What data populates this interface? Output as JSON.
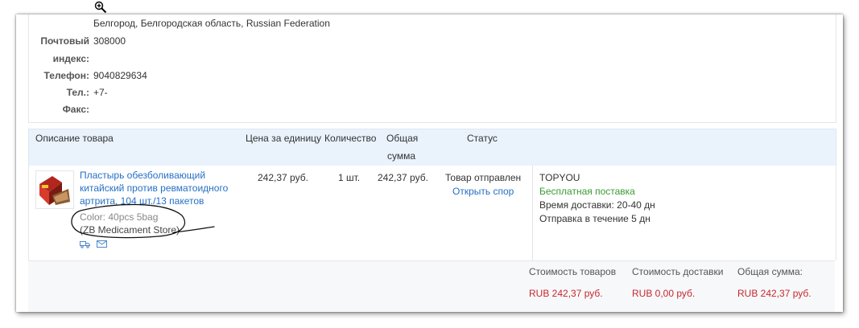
{
  "address": {
    "city_line": "Белгород, Белгородская область, Russian Federation",
    "postal_label_1": "Почтовый",
    "postal_label_2": "индекс:",
    "postal_value": "308000",
    "phone_label": "Телефон:",
    "phone_value": "9040829634",
    "tel_label": "Тел.:",
    "tel_value": "+7-",
    "fax_label": "Факс:",
    "fax_value": ""
  },
  "table": {
    "headers": {
      "description": "Описание товара",
      "unit_price": "Цена за единицу",
      "quantity": "Количество",
      "total_1": "Общая",
      "total_2": "сумма",
      "status": "Статус"
    }
  },
  "item": {
    "title": "Пластырь обезболивающий китайский против ревматоидного артрита, 104 шт./13 пакетов",
    "color": "Color: 40pcs 5bag",
    "store": "(ZB Medicament Store)",
    "unit_price": "242,37 руб.",
    "quantity": "1 шт.",
    "total": "242,37 руб.",
    "status": "Товар отправлен",
    "dispute_link": "Открыть спор",
    "seller": "TOPYOU",
    "free_shipping": "Бесплатная поставка",
    "delivery_time": "Время доставки:  20-40 дн",
    "dispatch_time": "Отправка в течение  5 дн"
  },
  "totals": {
    "goods_label": "Стоимость товаров",
    "goods_value": "RUB 242,37 руб.",
    "shipping_label": "Стоимость доставки",
    "shipping_value": "RUB 0,00 руб.",
    "total_label": "Общая сумма:",
    "total_value": "RUB 242,37 руб."
  },
  "colors": {
    "link": "#2570c4",
    "price_red": "#c5282e",
    "free_green": "#3a9b33",
    "header_bg": "#eaf3fc"
  },
  "icons": [
    "zoom-in-icon",
    "truck-icon",
    "message-icon"
  ]
}
